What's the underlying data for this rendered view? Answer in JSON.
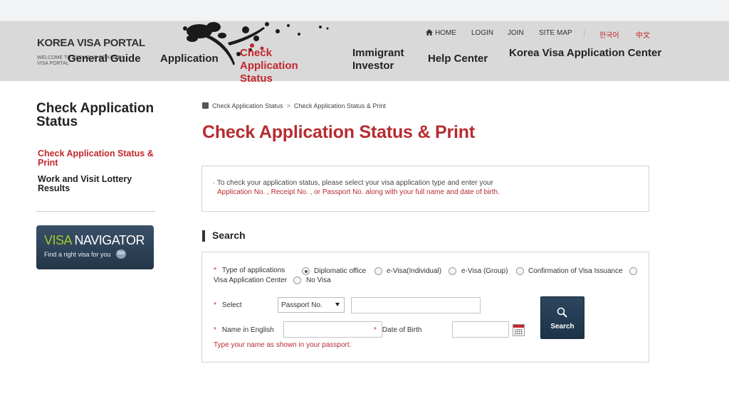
{
  "header": {
    "logo_title": "KOREA VISA PORTAL",
    "logo_sub": "WELCOME TO REPUBLIC OF KOREA VISA PORTAL",
    "nav": [
      {
        "label": "General Guide"
      },
      {
        "label": "Application"
      },
      {
        "label": "Check Application Status"
      },
      {
        "label": "Immigrant Investor"
      },
      {
        "label": "Help Center"
      },
      {
        "label": "Korea Visa Application Center"
      }
    ],
    "util": {
      "home": "HOME",
      "login": "LOGIN",
      "join": "JOIN",
      "sitemap": "SITE MAP",
      "korean": "한국어",
      "chinese": "中文"
    }
  },
  "sidebar": {
    "title": "Check Application Status",
    "items": [
      {
        "label": "Check Application Status & Print",
        "active": true
      },
      {
        "label": "Work and Visit Lottery Results",
        "active": false
      }
    ],
    "navigator": {
      "title_a": "VISA",
      "title_b": " NAVIGATOR",
      "subtitle": "Find a right visa for you",
      "go": "GO"
    }
  },
  "breadcrumb": {
    "items": [
      "Check Application Status",
      "Check Application Status & Print"
    ],
    "separator": ">"
  },
  "page_title": "Check Application Status & Print",
  "info": {
    "line1": "· To check your application status, please select your visa application type and enter your",
    "line2": "Application No. , Receipt No. , or Passport No. along with your full name and date of birth."
  },
  "search_section": {
    "title": "Search",
    "type_label": "Type of applications",
    "types": [
      {
        "label": "Diplomatic office",
        "selected": true
      },
      {
        "label": "e-Visa(Individual)",
        "selected": false
      },
      {
        "label": "e-Visa (Group)",
        "selected": false
      },
      {
        "label": "Confirmation of Visa Issuance",
        "selected": false
      },
      {
        "label": "Visa Application Center",
        "selected": false
      },
      {
        "label": "No Visa",
        "selected": false
      }
    ],
    "select_label": "Select",
    "select_value": "Passport No.",
    "select_input_value": "",
    "name_label": "Name in English",
    "name_value": "",
    "dob_label": "Date of Birth",
    "dob_value": "",
    "hint": "Type your name as shown in your passport.",
    "search_button": "Search",
    "required_mark": "*"
  },
  "colors": {
    "accent_red": "#c1272d",
    "header_bg": "#d9d9d9",
    "button_navy": "#243648"
  }
}
